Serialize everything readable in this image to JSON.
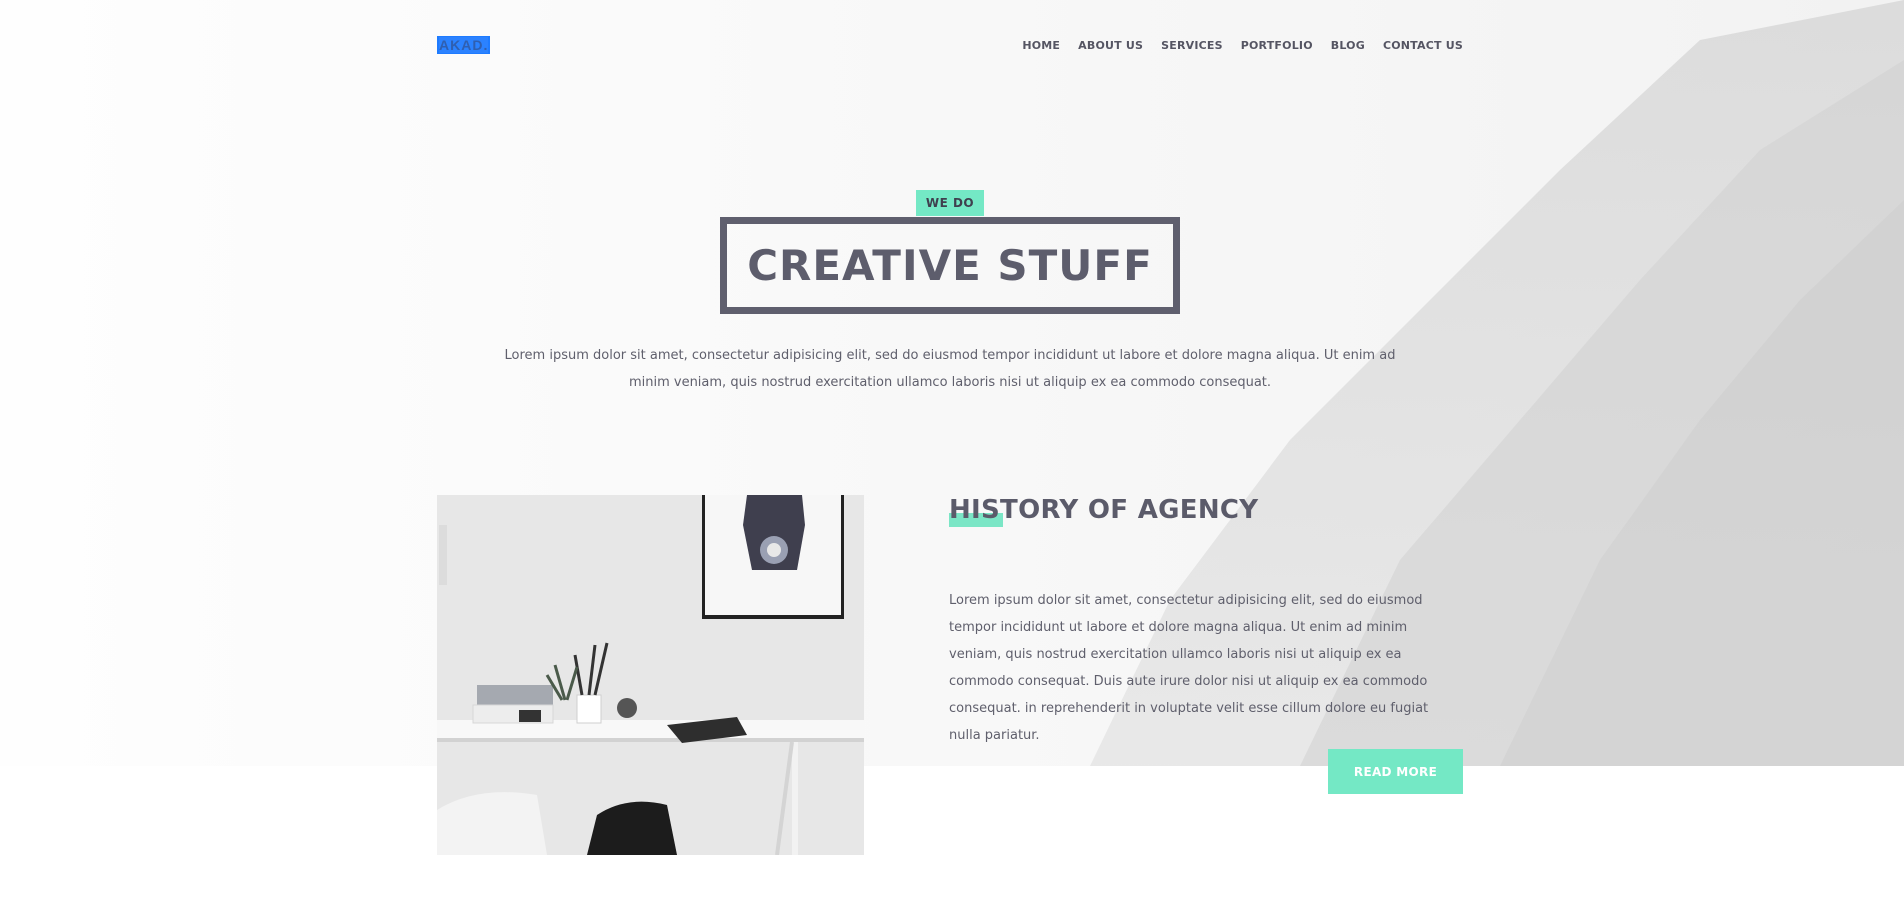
{
  "nav": {
    "logo": "AKAD.",
    "menu": [
      "HOME",
      "ABOUT US",
      "SERVICES",
      "PORTFOLIO",
      "BLOG",
      "CONTACT US"
    ]
  },
  "hero": {
    "badge": "WE DO",
    "title": "CREATIVE STUFF",
    "text": "Lorem ipsum dolor sit amet, consectetur adipisicing elit, sed do eiusmod tempor incididunt ut labore et dolore magna aliqua. Ut enim ad minim veniam, quis nostrud exercitation ullamco laboris nisi ut aliquip ex ea commodo consequat."
  },
  "history": {
    "title": "HISTORY OF AGENCY",
    "text": "Lorem ipsum dolor sit amet, consectetur adipisicing elit, sed do eiusmod tempor incididunt ut labore et dolore magna aliqua. Ut enim ad minim veniam, quis nostrud exercitation ullamco laboris nisi ut aliquip ex ea commodo consequat. Duis aute irure dolor nisi ut aliquip ex ea commodo consequat. in reprehenderit in voluptate velit esse cillum dolore eu fugiat nulla pariatur.",
    "button": "READ MORE"
  },
  "colors": {
    "accent": "#74e8c5",
    "text": "#5c5c6a",
    "logo_highlight": "#2b82ff"
  },
  "icons": {
    "hero_background": "forest-mountain-image",
    "office_photo": "desk-workspace-image"
  }
}
